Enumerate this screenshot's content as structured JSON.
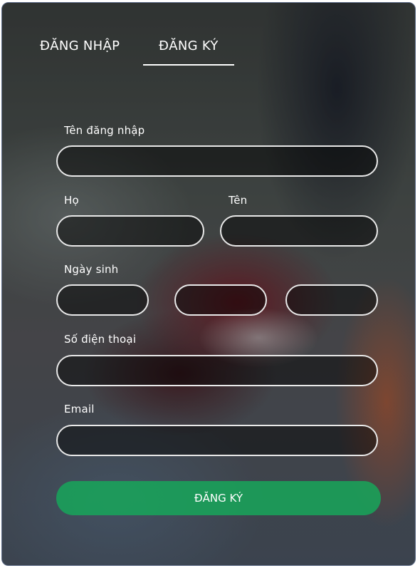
{
  "tabs": {
    "login_label": "ĐĂNG NHẬP",
    "register_label": "ĐĂNG KÝ",
    "active": "register"
  },
  "form": {
    "username": {
      "label": "Tên đăng nhập",
      "value": ""
    },
    "last_name": {
      "label": "Họ",
      "value": ""
    },
    "first_name": {
      "label": "Tên",
      "value": ""
    },
    "birthdate": {
      "label": "Ngày sinh",
      "day": "",
      "month": "",
      "year": ""
    },
    "phone": {
      "label": "Số điện thoại",
      "value": ""
    },
    "email": {
      "label": "Email",
      "value": ""
    },
    "submit_label": "ĐĂNG KÝ"
  },
  "colors": {
    "accent": "#16aa5a",
    "field_border": "#e9e9e9",
    "text": "#ffffff"
  }
}
